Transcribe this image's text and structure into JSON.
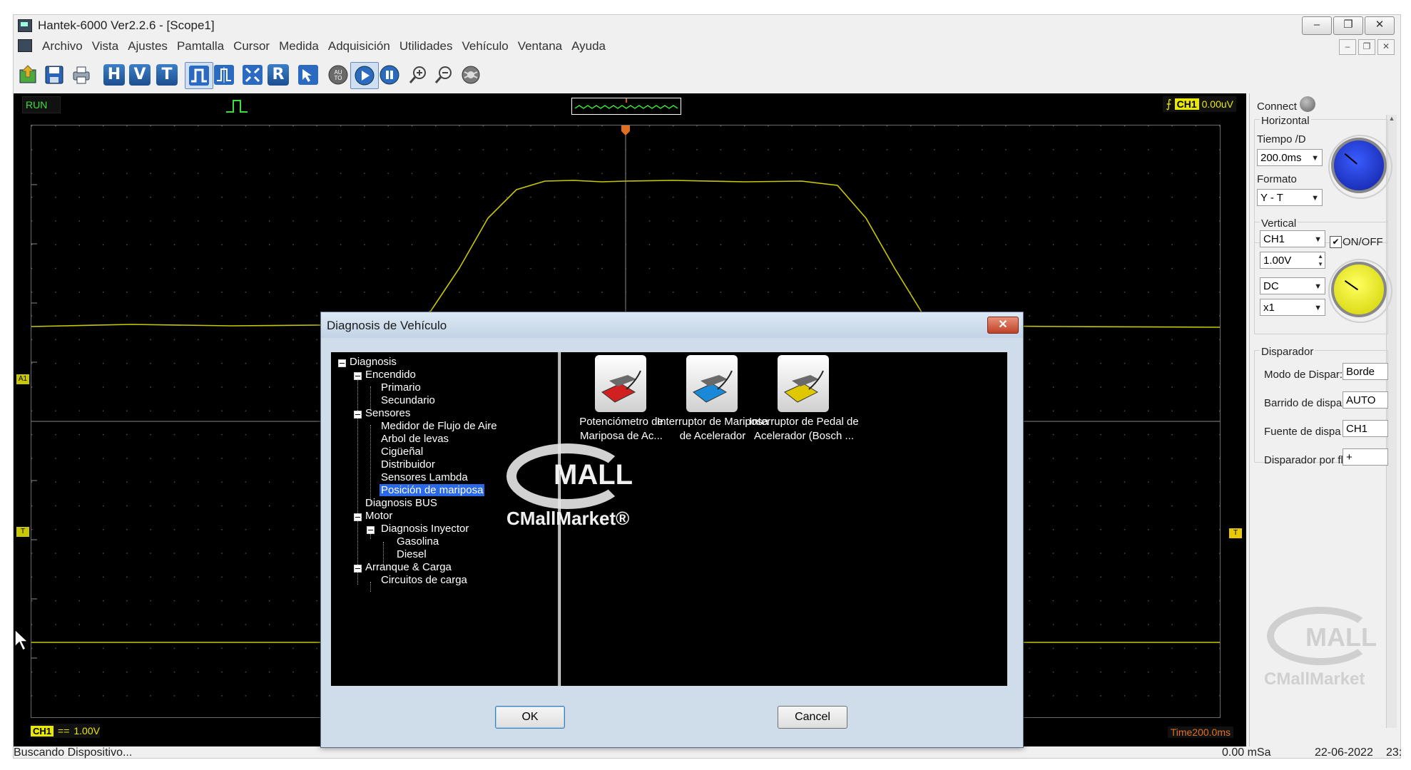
{
  "window": {
    "title": "Hantek-6000 Ver2.2.6 - [Scope1]",
    "controls": [
      "–",
      "❐",
      "✕"
    ],
    "mdi_controls": [
      "–",
      "❐",
      "✕"
    ]
  },
  "menu": [
    "Archivo",
    "Vista",
    "Ajustes",
    "Pamtalla",
    "Cursor",
    "Medida",
    "Adquisición",
    "Utilidades",
    "Vehículo",
    "Ventana",
    "Ayuda"
  ],
  "toolbar": {
    "h_label": "H",
    "v_label": "V",
    "t_label": "T",
    "r_label": "R",
    "auto_label": "AU\nTO"
  },
  "scope": {
    "run_status": "RUN",
    "trigger_channel": "CH1",
    "trigger_level": "0.00uV",
    "trigger_marker": "T",
    "ch1_marker": "A1",
    "ch1_badge": "CH1",
    "ch1_coupling_symbol": "==",
    "ch1_scale": "1.00V",
    "time_readout": "Time200.0ms",
    "trace_color": "#c8c800",
    "accent": "#e8e800"
  },
  "panel": {
    "connect_label": "Connect",
    "horizontal": {
      "title": "Horizontal",
      "time_label": "Tiempo /D",
      "time_value": "200.0ms",
      "format_label": "Formato",
      "format_value": "Y - T",
      "knob_color": "#1a3fd0"
    },
    "vertical": {
      "title": "Vertical",
      "channel": "CH1",
      "onoff_label": "ON/OFF",
      "onoff_checked": true,
      "volts": "1.00V",
      "coupling": "DC",
      "probe": "x1",
      "knob_color": "#f0f000"
    },
    "trigger": {
      "title": "Disparador",
      "rows": [
        {
          "label": "Modo de Dispar:",
          "value": "Borde"
        },
        {
          "label": "Barrido de dispa",
          "value": "AUTO"
        },
        {
          "label": "Fuente de dispa",
          "value": "CH1"
        },
        {
          "label": "Disparador por fl",
          "value": "+"
        }
      ]
    },
    "watermark_logo": "MALL",
    "watermark_text": "CMallMarket"
  },
  "status": {
    "left": "Buscando Dispositivo...",
    "sample": "0.00 mSa",
    "date": "22-06-2022",
    "time": "23:"
  },
  "dialog": {
    "title": "Diagnosis de Vehículo",
    "close": "✕",
    "tree": [
      {
        "label": "Diagnosis",
        "level": 0,
        "expandable": true
      },
      {
        "label": "Encendido",
        "level": 1,
        "expandable": true
      },
      {
        "label": "Primario",
        "level": 2
      },
      {
        "label": "Secundario",
        "level": 2
      },
      {
        "label": "Sensores",
        "level": 1,
        "expandable": true
      },
      {
        "label": "Medidor de Flujo de Aire",
        "level": 2
      },
      {
        "label": "Arbol de levas",
        "level": 2
      },
      {
        "label": "Cigüeñal",
        "level": 2
      },
      {
        "label": "Distribuidor",
        "level": 2
      },
      {
        "label": "Sensores Lambda",
        "level": 2
      },
      {
        "label": "Posición de mariposa",
        "level": 2,
        "selected": true
      },
      {
        "label": "Diagnosis BUS",
        "level": 1
      },
      {
        "label": "Motor",
        "level": 1,
        "expandable": true
      },
      {
        "label": "Diagnosis Inyector",
        "level": 2,
        "expandable": true
      },
      {
        "label": "Gasolina",
        "level": 3
      },
      {
        "label": "Diesel",
        "level": 3
      },
      {
        "label": "Arranque & Carga",
        "level": 1,
        "expandable": true
      },
      {
        "label": "Circuitos de carga",
        "level": 2
      }
    ],
    "items": [
      {
        "line1": "Potenciómetro de",
        "line2": "Mariposa de Ac...",
        "clip_color": "#d02020"
      },
      {
        "line1": "Interruptor de Mariposa",
        "line2": "de Acelerador",
        "clip_color": "#1a8ad8"
      },
      {
        "line1": "Interruptor de Pedal de",
        "line2": "Acelerador (Bosch ...",
        "clip_color": "#e0c800"
      }
    ],
    "ok": "OK",
    "cancel": "Cancel",
    "watermark_logo": "MALL",
    "watermark_text": "CMallMarket®"
  }
}
